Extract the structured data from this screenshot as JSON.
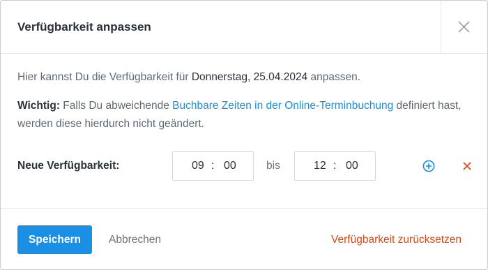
{
  "dialog": {
    "title": "Verfügbarkeit anpassen",
    "close_icon": "close-icon"
  },
  "intro": {
    "prefix": "Hier kannst Du die Verfügbarkeit für ",
    "date": "Donnerstag, 25.04.2024",
    "suffix": " anpassen."
  },
  "notice": {
    "label": "Wichtig:",
    "text_before": " Falls Du abweichende ",
    "link": "Buchbare Zeiten in der Online-Terminbuchung",
    "text_after": " definiert hast, werden diese hierdurch nicht geändert."
  },
  "availability": {
    "label": "Neue Verfügbarkeit:",
    "from": {
      "hours": "09",
      "separator": ":",
      "minutes": "00"
    },
    "between": "bis",
    "to": {
      "hours": "12",
      "separator": ":",
      "minutes": "00"
    },
    "add_icon": "plus-circle-icon",
    "remove_icon": "close-icon"
  },
  "footer": {
    "save_label": "Speichern",
    "cancel_label": "Abbrechen",
    "reset_label": "Verfügbarkeit zurücksetzen"
  },
  "colors": {
    "primary": "#1a8fe3",
    "link": "#1a8fd8",
    "danger": "#d9480f",
    "text": "#2a3138",
    "muted": "#5f6872"
  }
}
